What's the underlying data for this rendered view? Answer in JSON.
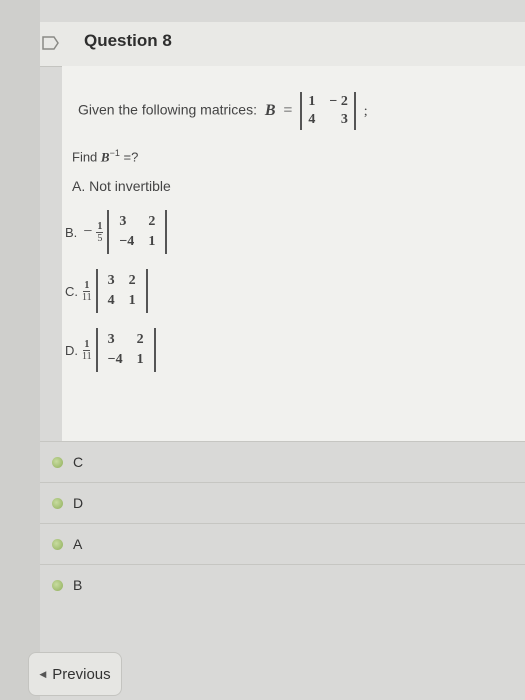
{
  "question": {
    "title": "Question 8",
    "prompt": "Given the following matrices:",
    "matrix_name": "B",
    "equals": "=",
    "matrix_B": [
      [
        "1",
        "− 2"
      ],
      [
        "4",
        "3"
      ]
    ],
    "semicolon": ";",
    "find_label": "Find",
    "find_expr": "B",
    "find_exponent": "−1",
    "find_suffix": "=?"
  },
  "options": {
    "a": "A. Not invertible",
    "b": {
      "label": "B.",
      "sign": "−",
      "num": "1",
      "den": "5",
      "matrix": [
        [
          "3",
          "2"
        ],
        [
          "−4",
          "1"
        ]
      ]
    },
    "c": {
      "label": "C.",
      "sign": "",
      "num": "1",
      "den": "11",
      "matrix": [
        [
          "3",
          "2"
        ],
        [
          "4",
          "1"
        ]
      ]
    },
    "d": {
      "label": "D.",
      "sign": "",
      "num": "1",
      "den": "11",
      "matrix": [
        [
          "3",
          "2"
        ],
        [
          "−4",
          "1"
        ]
      ]
    }
  },
  "answer_choices": [
    "C",
    "D",
    "A",
    "B"
  ],
  "nav": {
    "previous_label": "Previous",
    "previous_icon": "caret-left-icon"
  },
  "colors": {
    "radio": "#8fae5a",
    "background": "#d9d9d7"
  }
}
